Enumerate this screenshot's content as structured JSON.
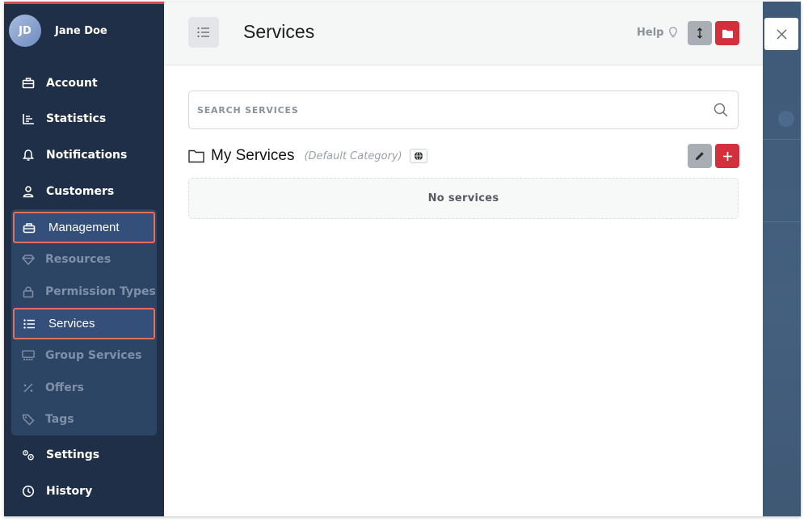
{
  "user": {
    "initials": "JD",
    "name": "Jane Doe"
  },
  "nav": [
    {
      "label": "Account",
      "icon": "briefcase-icon"
    },
    {
      "label": "Statistics",
      "icon": "chart-icon"
    },
    {
      "label": "Notifications",
      "icon": "bell-icon"
    },
    {
      "label": "Customers",
      "icon": "user-icon"
    }
  ],
  "management": {
    "label": "Management",
    "icon": "toolbox-icon",
    "items": [
      {
        "label": "Resources",
        "icon": "gem-icon"
      },
      {
        "label": "Permission Types",
        "icon": "lock-icon"
      },
      {
        "label": "Services",
        "icon": "list-icon",
        "active": true
      },
      {
        "label": "Group Services",
        "icon": "group-icon"
      },
      {
        "label": "Offers",
        "icon": "percent-icon"
      },
      {
        "label": "Tags",
        "icon": "tag-icon"
      }
    ]
  },
  "bottom_nav": [
    {
      "label": "Settings",
      "icon": "gears-icon"
    },
    {
      "label": "History",
      "icon": "clock-icon"
    }
  ],
  "panel": {
    "title": "Services",
    "help_label": "Help",
    "search_placeholder": "SEARCH SERVICES",
    "category": {
      "name": "My Services",
      "note": "(Default Category)"
    },
    "empty_text": "No services"
  },
  "colors": {
    "sidebar": "#1f2f47",
    "subpanel": "#2d4564",
    "accent_red": "#d32f3d",
    "highlight_border": "#e36f5a"
  }
}
